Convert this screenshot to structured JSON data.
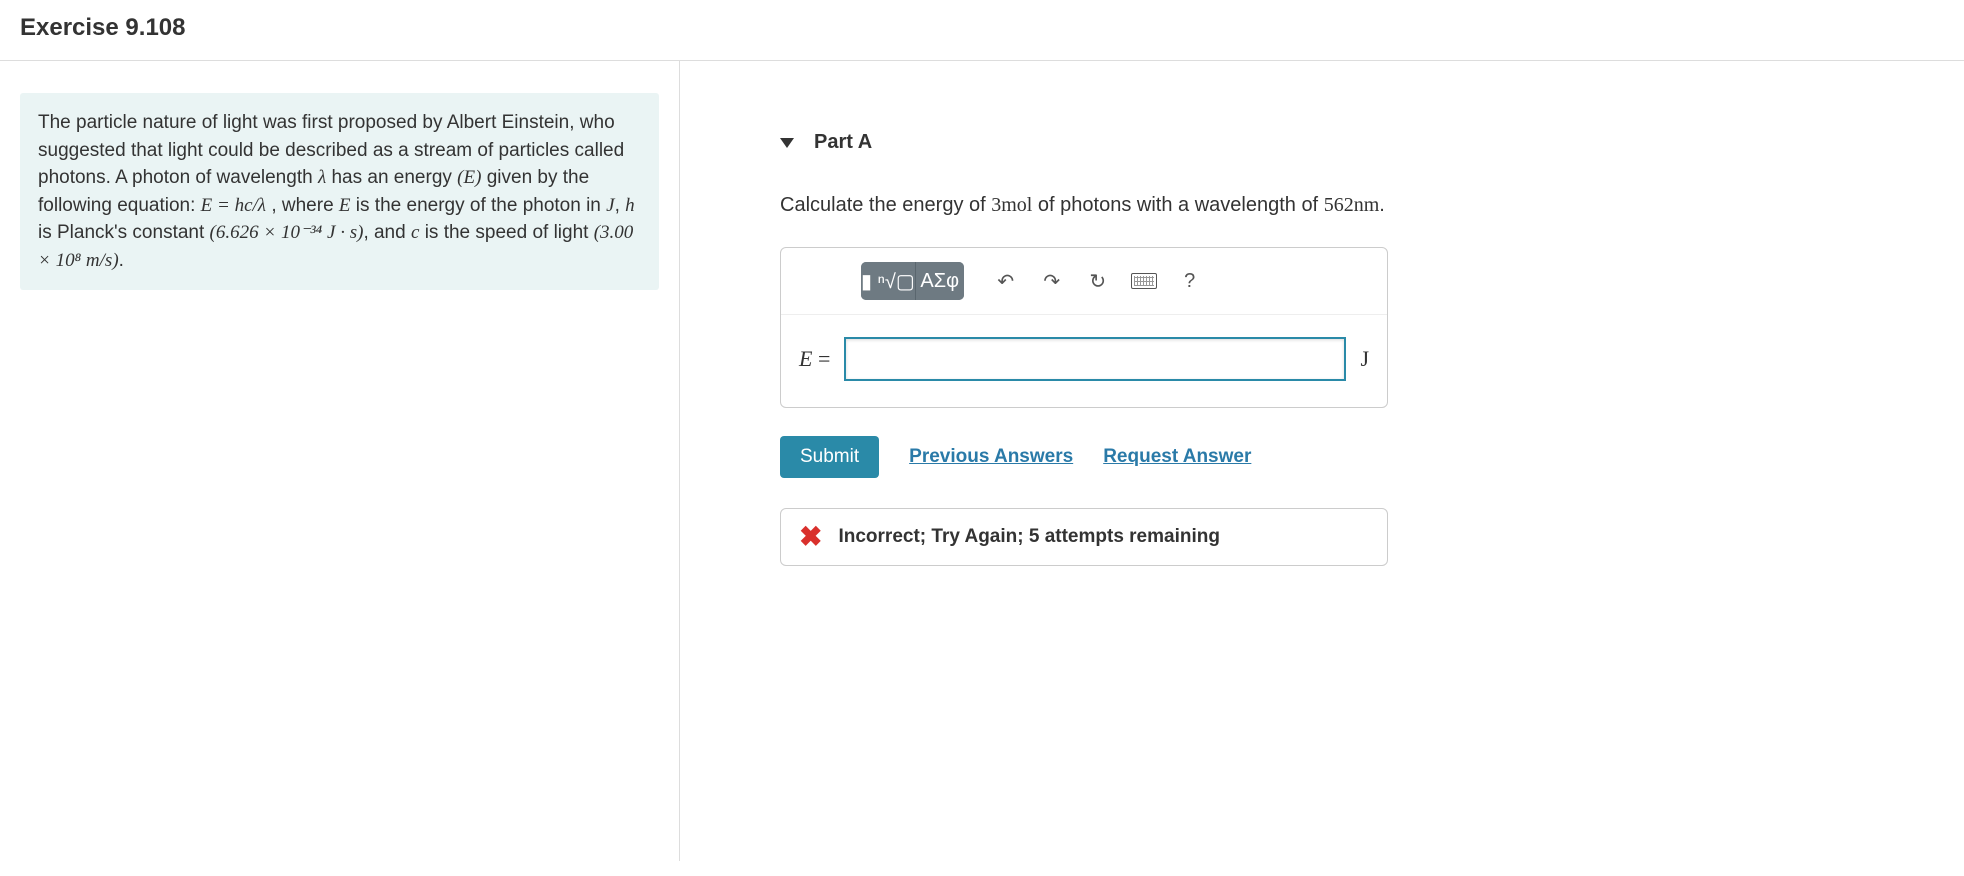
{
  "header": {
    "title": "Exercise 9.108"
  },
  "intro": {
    "text_parts": {
      "p1": "The particle nature of light was first proposed by Albert Einstein, who suggested that light could be described as a stream of particles called photons. A photon of wavelength ",
      "lambda": "λ",
      "p2": " has an energy ",
      "E_paren": "(E)",
      "p3": " given by the following equation: ",
      "eq": "E = hc/λ",
      "p4": " , where ",
      "E": "E",
      "p5": " is the energy of the photon in ",
      "J": "J",
      "p6": ", ",
      "h": "h",
      "p7": " is Planck's constant ",
      "planck": "(6.626 × 10⁻³⁴ J · s)",
      "p8": ", and ",
      "c": "c",
      "p9": " is the speed of light ",
      "speed": "(3.00 × 10⁸ m/s)",
      "p10": "."
    }
  },
  "part": {
    "label": "Part A",
    "question_parts": {
      "q1": "Calculate the energy of ",
      "mol": "3mol",
      "q2": " of photons with a wavelength of ",
      "wl": "562nm",
      "q3": "."
    }
  },
  "toolbar": {
    "templates_label": "▮ ⁿ√▢",
    "greek_label": "ΑΣφ",
    "undo": "↶",
    "redo": "↷",
    "reset": "↻",
    "help": "?"
  },
  "answer": {
    "lhs_var": "E",
    "lhs_eq": " =",
    "value": "",
    "unit": "J"
  },
  "actions": {
    "submit": "Submit",
    "previous": "Previous Answers",
    "request": "Request Answer"
  },
  "feedback": {
    "icon_glyph": "✖",
    "text": "Incorrect; Try Again; 5 attempts remaining"
  }
}
